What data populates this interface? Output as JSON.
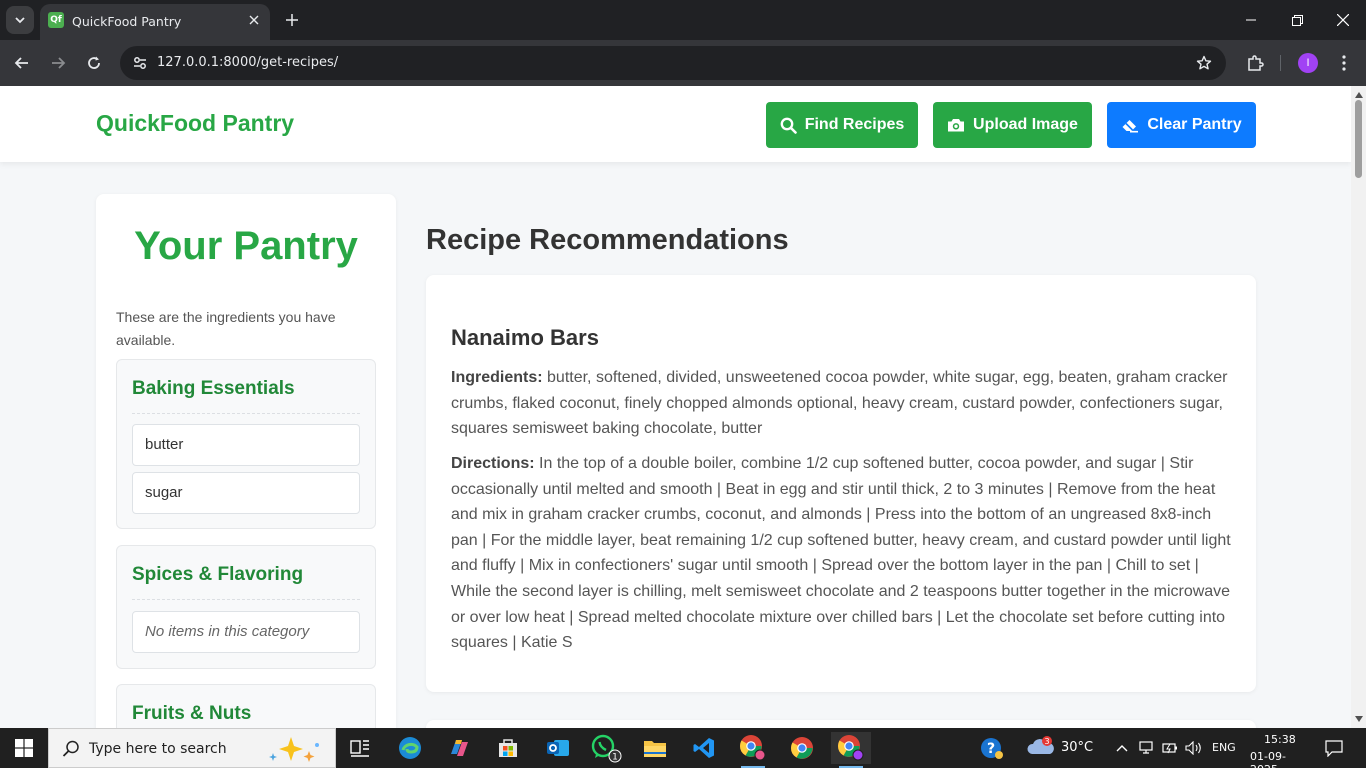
{
  "browser": {
    "tab_title": "QuickFood Pantry",
    "favicon_text": "Qf",
    "url": "127.0.0.1:8000/get-recipes/",
    "profile_initial": "I"
  },
  "header": {
    "brand": "QuickFood Pantry",
    "buttons": {
      "find": "Find Recipes",
      "upload": "Upload Image",
      "clear": "Clear Pantry"
    },
    "colors": {
      "primary": "#28a745",
      "accent": "#0d7bff"
    }
  },
  "pantry": {
    "title": "Your Pantry",
    "description": "These are the ingredients you have available.",
    "categories": [
      {
        "title": "Baking Essentials",
        "items": [
          "butter",
          "sugar"
        ]
      },
      {
        "title": "Spices & Flavoring",
        "empty_text": "No items in this category"
      },
      {
        "title": "Fruits & Nuts"
      }
    ]
  },
  "recipes": {
    "heading": "Recipe Recommendations",
    "items": [
      {
        "name": "Nanaimo Bars",
        "ingredients_label": "Ingredients:",
        "ingredients": "butter, softened, divided, unsweetened cocoa powder, white sugar, egg, beaten, graham cracker crumbs, flaked coconut, finely chopped almonds optional, heavy cream, custard powder, confectioners sugar, squares semisweet baking chocolate, butter",
        "directions_label": "Directions:",
        "directions": "In the top of a double boiler, combine 1/2 cup softened butter, cocoa powder, and sugar | Stir occasionally until melted and smooth | Beat in egg and stir until thick, 2 to 3 minutes | Remove from the heat and mix in graham cracker crumbs, coconut, and almonds | Press into the bottom of an ungreased 8x8-inch pan | For the middle layer, beat remaining 1/2 cup softened butter, heavy cream, and custard powder until light and fluffy | Mix in confectioners' sugar until smooth | Spread over the bottom layer in the pan | Chill to set | While the second layer is chilling, melt semisweet chocolate and 2 teaspoons butter together in the microwave or over low heat | Spread melted chocolate mixture over chilled bars | Let the chocolate set before cutting into squares | Katie S"
      }
    ]
  },
  "taskbar": {
    "search_placeholder": "Type here to search",
    "weather_temp": "30°C",
    "weather_badge": "3",
    "whatsapp_badge": "1",
    "language": "ENG",
    "time": "15:38",
    "date": "01-09-2025"
  }
}
